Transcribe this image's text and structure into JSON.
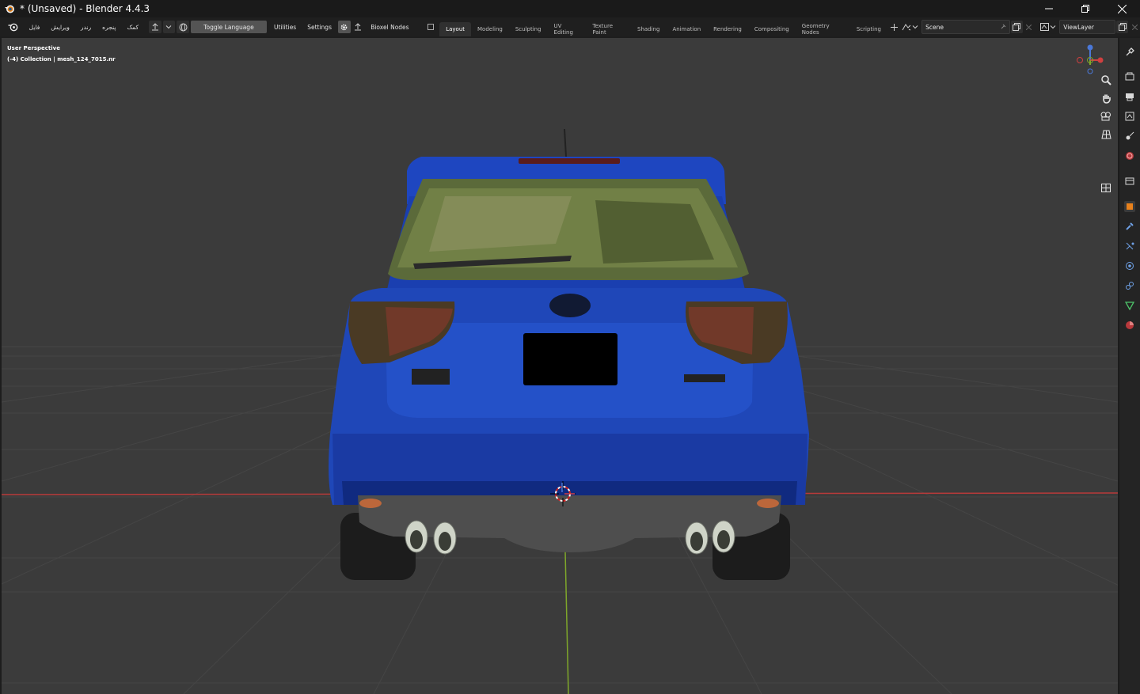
{
  "window": {
    "title": "* (Unsaved) - Blender 4.4.3",
    "controls": [
      "minimize-icon",
      "restore-icon",
      "close-icon"
    ]
  },
  "topbar": {
    "menus": [
      "فایل",
      "ویرایش",
      "رندر",
      "پنجره",
      "کمک"
    ],
    "toggle_language": "Toggle Language",
    "utilities": "Utilities",
    "settings": "Settings",
    "bioxel_nodes": "Bioxel Nodes",
    "workspace_tabs": [
      "Layout",
      "Modeling",
      "Sculpting",
      "UV Editing",
      "Texture Paint",
      "Shading",
      "Animation",
      "Rendering",
      "Compositing",
      "Geometry Nodes",
      "Scripting"
    ],
    "active_tab": "Layout",
    "scene_name": "Scene",
    "view_layer": "ViewLayer"
  },
  "viewport": {
    "perspective_label": "User Perspective",
    "collection_label": "(-4) Collection | mesh_124_7015.nr",
    "nav_tools": [
      "zoom-icon",
      "hand-pan-icon",
      "camera-icon",
      "grid-ortho-icon"
    ]
  },
  "properties_tabs": [
    "tool-icon",
    "render-icon",
    "output-icon",
    "view-layer-icon",
    "scene-icon",
    "world-icon",
    "collection-icon",
    "object-icon",
    "modifier-icon",
    "particles-icon",
    "physics-icon",
    "constraints-icon",
    "data-icon",
    "material-icon"
  ],
  "colors": {
    "car_body": "#1f47b8",
    "axis_x": "#c43a3a",
    "axis_y": "#7fa72a",
    "active_tab_bg": "#303030",
    "grid_bg": "#3b3b3b"
  }
}
